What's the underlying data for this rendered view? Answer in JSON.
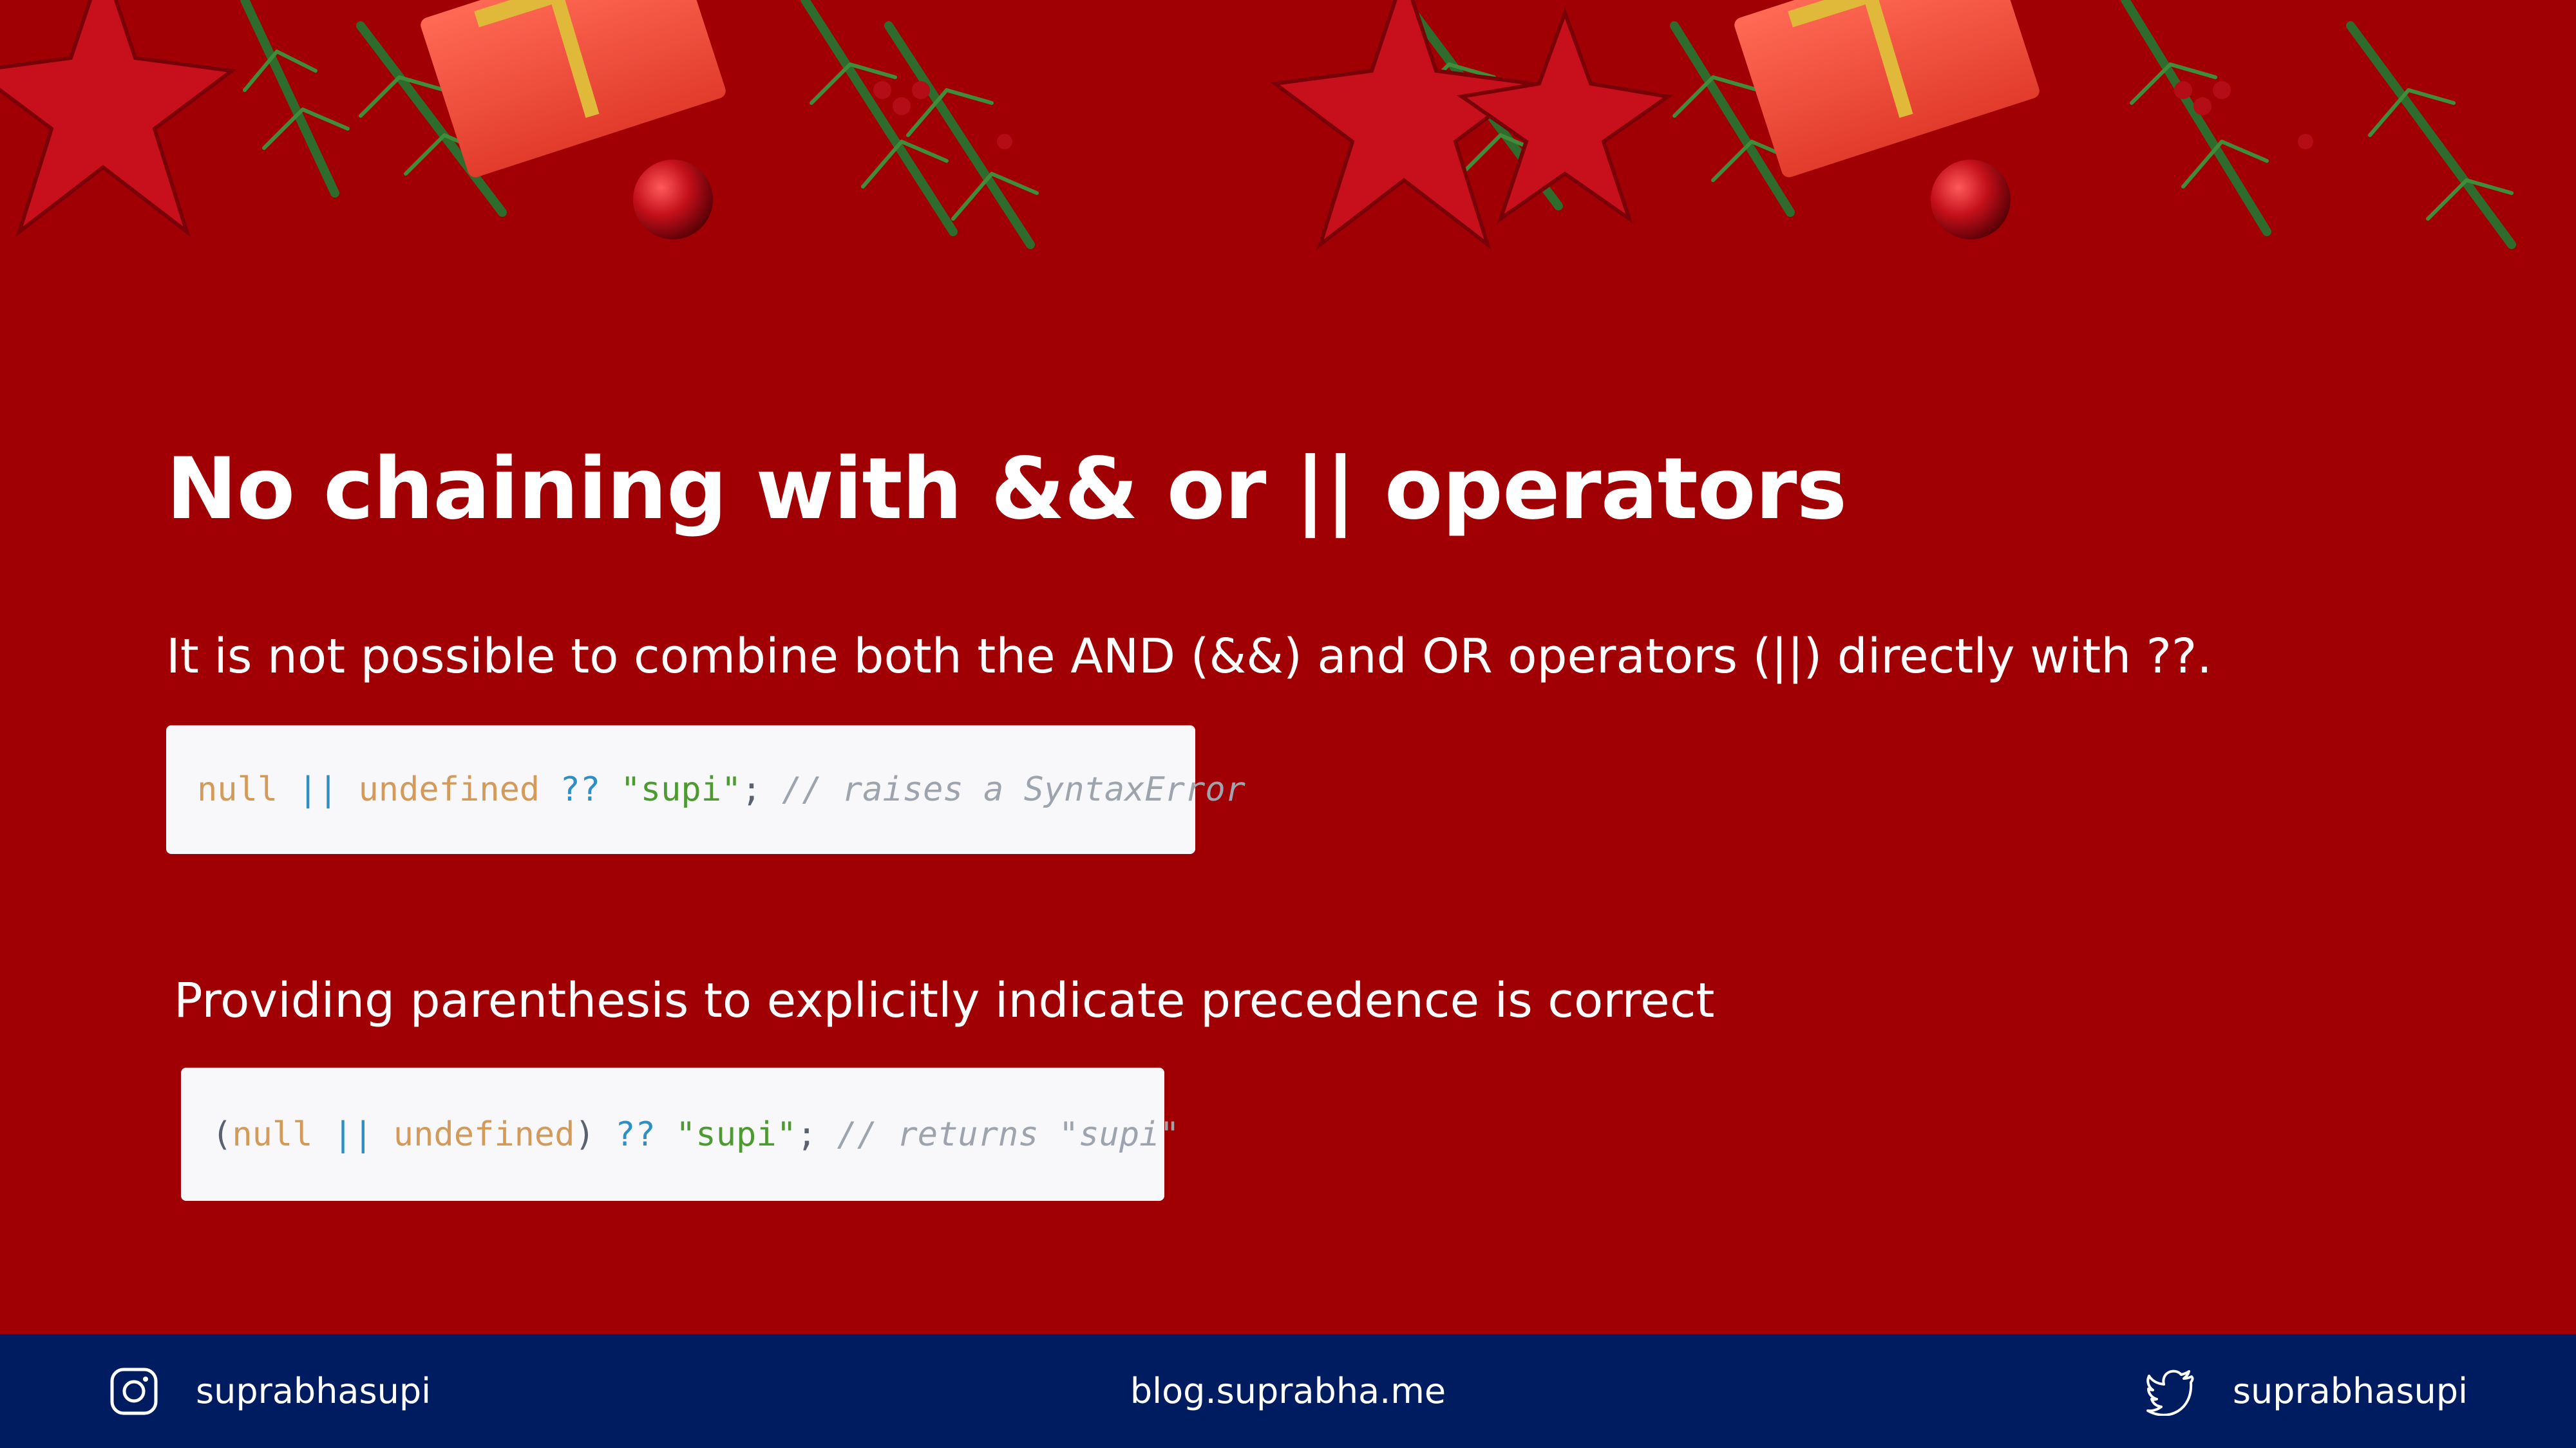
{
  "slide": {
    "title": "No chaining with && or || operators",
    "paragraph_1": "It is not possible to combine both the AND (&&) and OR operators (||) directly with ??.",
    "code_1": [
      {
        "type": "kw",
        "text": "null"
      },
      {
        "type": "op",
        "text": " || "
      },
      {
        "type": "kw",
        "text": "undefined"
      },
      {
        "type": "op",
        "text": " ?? "
      },
      {
        "type": "str",
        "text": "\"supi\""
      },
      {
        "type": "punc",
        "text": "; "
      },
      {
        "type": "com",
        "text": "// raises a SyntaxError"
      }
    ],
    "paragraph_2": "Providing parenthesis to explicitly indicate precedence is correct",
    "code_2": [
      {
        "type": "punc",
        "text": "("
      },
      {
        "type": "kw",
        "text": "null"
      },
      {
        "type": "op",
        "text": " || "
      },
      {
        "type": "kw",
        "text": "undefined"
      },
      {
        "type": "punc",
        "text": ")"
      },
      {
        "type": "op",
        "text": " ?? "
      },
      {
        "type": "str",
        "text": "\"supi\""
      },
      {
        "type": "punc",
        "text": "; "
      },
      {
        "type": "com",
        "text": "// returns \"supi\""
      }
    ]
  },
  "footer": {
    "instagram_handle": "suprabhasupi",
    "instagram_icon": "instagram-icon",
    "website": "blog.suprabha.me",
    "twitter_handle": "suprabhasupi",
    "twitter_icon": "twitter-icon"
  },
  "colors": {
    "background": "#a00003",
    "footer": "#001c61",
    "code_background": "#f8f8fa",
    "keyword": "#d39a5a",
    "operator": "#2f8fc2",
    "string": "#4e9a32",
    "comment": "#9ea4ad"
  },
  "decoration": {
    "description_icon": "christmas-garland-icon"
  }
}
